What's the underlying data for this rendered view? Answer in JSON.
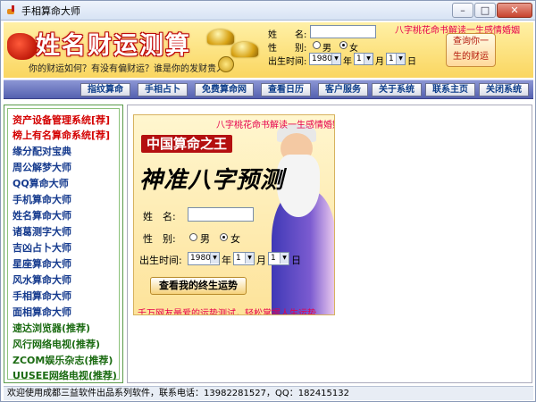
{
  "window": {
    "title": "手相算命大师",
    "min_label": "–",
    "max_label": "□",
    "close_label": "✕"
  },
  "banner": {
    "title": "姓名财运测算",
    "subtitle": "你的财运如何？有没有偏财运？谁是你的发财贵人？",
    "name_label": "姓　　名:",
    "name_value": "",
    "gender_label": "性　　别:",
    "male": "男",
    "female": "女",
    "birth_label": "出生时间:",
    "year": "1980",
    "year_unit": "年",
    "month": "1",
    "month_unit": "月",
    "day": "1",
    "day_unit": "日",
    "promo_link": "八字桃花命书解读一生感情婚姻",
    "promo_box": [
      "查询你一",
      "生的财运"
    ]
  },
  "nav": {
    "items": [
      "指纹算命",
      "手相占卜",
      "免费算命网",
      "查看日历",
      "客户服务",
      "关于系统",
      "联系主页",
      "关闭系统"
    ]
  },
  "sidebar": {
    "items": [
      {
        "label": "资产设备管理系统[荐]",
        "color": "#d40000"
      },
      {
        "label": "榜上有名算命系统[荐]",
        "color": "#d40000"
      },
      {
        "label": "缘分配对宝典",
        "color": "#163b8e"
      },
      {
        "label": "周公解梦大师",
        "color": "#163b8e"
      },
      {
        "label": "QQ算命大师",
        "color": "#163b8e"
      },
      {
        "label": "手机算命大师",
        "color": "#163b8e"
      },
      {
        "label": "姓名算命大师",
        "color": "#163b8e"
      },
      {
        "label": "诸葛测字大师",
        "color": "#163b8e"
      },
      {
        "label": "吉凶占卜大师",
        "color": "#163b8e"
      },
      {
        "label": "星座算命大师",
        "color": "#163b8e"
      },
      {
        "label": "风水算命大师",
        "color": "#163b8e"
      },
      {
        "label": "手相算命大师",
        "color": "#163b8e"
      },
      {
        "label": "面相算命大师",
        "color": "#163b8e"
      },
      {
        "label": "速达浏览器(推荐)",
        "color": "#1b6b12"
      },
      {
        "label": "风行网络电视(推荐)",
        "color": "#1b6b12"
      },
      {
        "label": "ZCOM娱乐杂志(推荐)",
        "color": "#1b6b12"
      },
      {
        "label": "UUSEE网络电视(推荐)",
        "color": "#1b6b12"
      }
    ]
  },
  "ad": {
    "top_link": "八字桃花命书解读一生感情婚姻",
    "red_title": "中国算命之王",
    "script_title": "神准八字预测",
    "name_label": "姓　名:",
    "gender_label": "性　别:",
    "male": "男",
    "female": "女",
    "birth_label": "出生时间:",
    "year": "1980",
    "year_unit": "年",
    "month": "1",
    "month_unit": "月",
    "day": "1",
    "day_unit": "日",
    "button": "查看我的终生运势",
    "footer": "千万网友最爱的运势测试，轻松掌握人生运势"
  },
  "status": {
    "text": "欢迎使用成都三益软件出品系列软件，联系电话：13982281527，QQ：182415132"
  }
}
